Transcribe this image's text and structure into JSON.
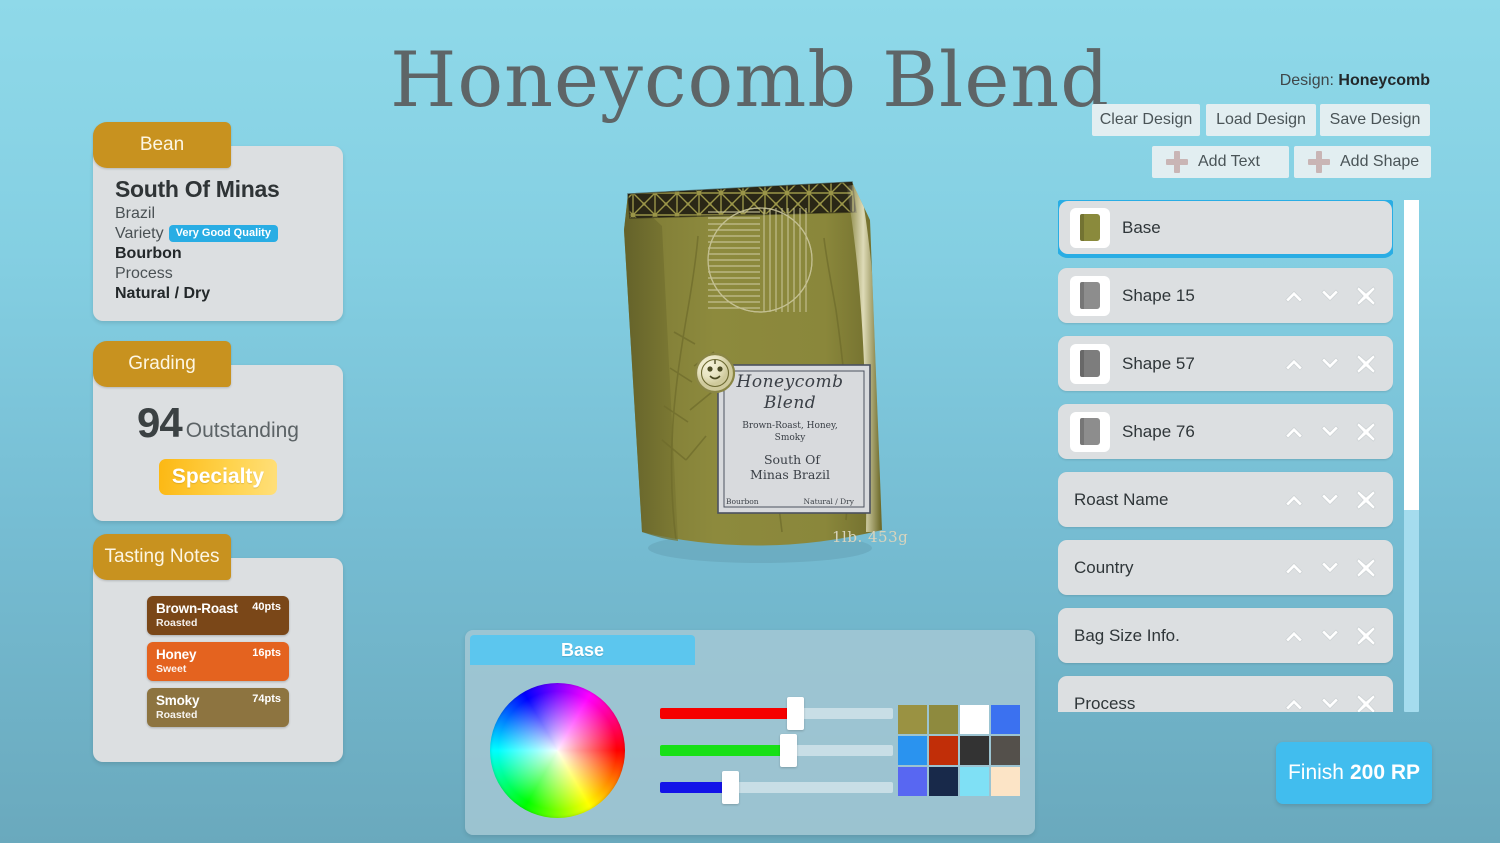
{
  "title": "Honeycomb Blend",
  "design": {
    "prefix": "Design:",
    "name": "Honeycomb"
  },
  "toolbar": {
    "clear": "Clear Design",
    "load": "Load Design",
    "save": "Save Design",
    "add_text": "Add Text",
    "add_shape": "Add Shape"
  },
  "bean": {
    "tab": "Bean",
    "name": "South Of Minas",
    "country": "Brazil",
    "variety_label": "Variety",
    "variety_badge": "Very Good Quality",
    "variety_value": "Bourbon",
    "process_label": "Process",
    "process_value": "Natural / Dry"
  },
  "grading": {
    "tab": "Grading",
    "score": "94",
    "word": "Outstanding",
    "pill": "Specialty"
  },
  "tasting": {
    "tab": "Tasting Notes",
    "notes": [
      {
        "name": "Brown-Roast",
        "sub": "Roasted",
        "pts": "40pts",
        "color": "#7a4718"
      },
      {
        "name": "Honey",
        "sub": "Sweet",
        "pts": "16pts",
        "color": "#e4631f"
      },
      {
        "name": "Smoky",
        "sub": "Roasted",
        "pts": "74pts",
        "color": "#8d7440"
      }
    ]
  },
  "layers": [
    {
      "label": "Base",
      "selected": true,
      "thumb": "#8a8a3c",
      "controls": false
    },
    {
      "label": "Shape 15",
      "selected": false,
      "thumb": "#8d8d8d",
      "controls": true
    },
    {
      "label": "Shape 57",
      "selected": false,
      "thumb": "#7d7d7d",
      "controls": true
    },
    {
      "label": "Shape 76",
      "selected": false,
      "thumb": "#8d8d8d",
      "controls": true
    },
    {
      "label": "Roast Name",
      "selected": false,
      "thumb": null,
      "controls": true
    },
    {
      "label": "Country",
      "selected": false,
      "thumb": null,
      "controls": true
    },
    {
      "label": "Bag Size Info.",
      "selected": false,
      "thumb": null,
      "controls": true
    },
    {
      "label": "Process",
      "selected": false,
      "thumb": null,
      "controls": true
    }
  ],
  "color_panel": {
    "tab": "Base",
    "sliders": [
      {
        "channel": "R",
        "value": 58,
        "color": "#f50000"
      },
      {
        "channel": "G",
        "value": 55,
        "color": "#17e017"
      },
      {
        "channel": "B",
        "value": 30,
        "color": "#1313e8"
      }
    ],
    "swatches": [
      "#9a9242",
      "#8e8a3e",
      "#ffffff",
      "#3b71f0",
      "#2a93ef",
      "#c12e08",
      "#333333",
      "#54504b",
      "#5867f2",
      "#18294a",
      "#7fe0f5",
      "#fce4c6"
    ]
  },
  "finish": {
    "label": "Finish",
    "price": "200 RP"
  },
  "bag": {
    "label_name_line1": "Honeycomb",
    "label_name_line2": "Blend",
    "notes_line1": "Brown-Roast, Honey,",
    "notes_line2": "Smoky",
    "origin": "South Of Minas",
    "country": "Brazil",
    "variety": "Bourbon",
    "process": "Natural / Dry",
    "weight": "1lb. 453g"
  }
}
